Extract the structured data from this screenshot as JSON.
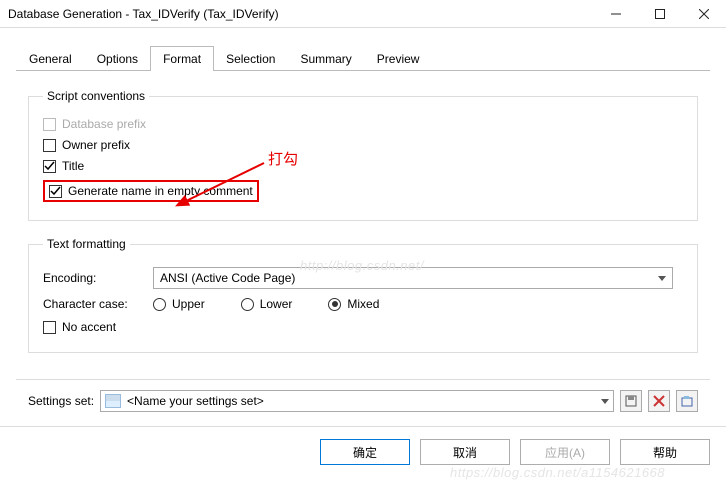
{
  "window": {
    "title": "Database Generation - Tax_IDVerify (Tax_IDVerify)"
  },
  "tabs": {
    "items": [
      {
        "label": "General"
      },
      {
        "label": "Options"
      },
      {
        "label": "Format"
      },
      {
        "label": "Selection"
      },
      {
        "label": "Summary"
      },
      {
        "label": "Preview"
      }
    ],
    "active_index": 2
  },
  "script_conventions": {
    "legend": "Script conventions",
    "database_prefix": {
      "label": "Database prefix",
      "checked": false,
      "disabled": true
    },
    "owner_prefix": {
      "label": "Owner prefix",
      "checked": false,
      "disabled": false
    },
    "title": {
      "label": "Title",
      "checked": true,
      "disabled": false
    },
    "generate_name": {
      "label": "Generate name in empty comment",
      "checked": true,
      "disabled": false
    }
  },
  "text_formatting": {
    "legend": "Text formatting",
    "encoding_label": "Encoding:",
    "encoding_value": "ANSI (Active Code Page)",
    "char_case_label": "Character case:",
    "case_options": {
      "upper": "Upper",
      "lower": "Lower",
      "mixed": "Mixed"
    },
    "case_selected": "mixed",
    "no_accent": {
      "label": "No accent",
      "checked": false
    }
  },
  "settings": {
    "label": "Settings set:",
    "value": "<Name your settings set>"
  },
  "buttons": {
    "ok": "确定",
    "cancel": "取消",
    "apply": "应用(A)",
    "help": "帮助"
  },
  "annotation": {
    "text": "打勾"
  },
  "watermarks": {
    "w1": "http://blog.csdn.net/",
    "w2": "https://blog.csdn.net/a1154621668"
  }
}
